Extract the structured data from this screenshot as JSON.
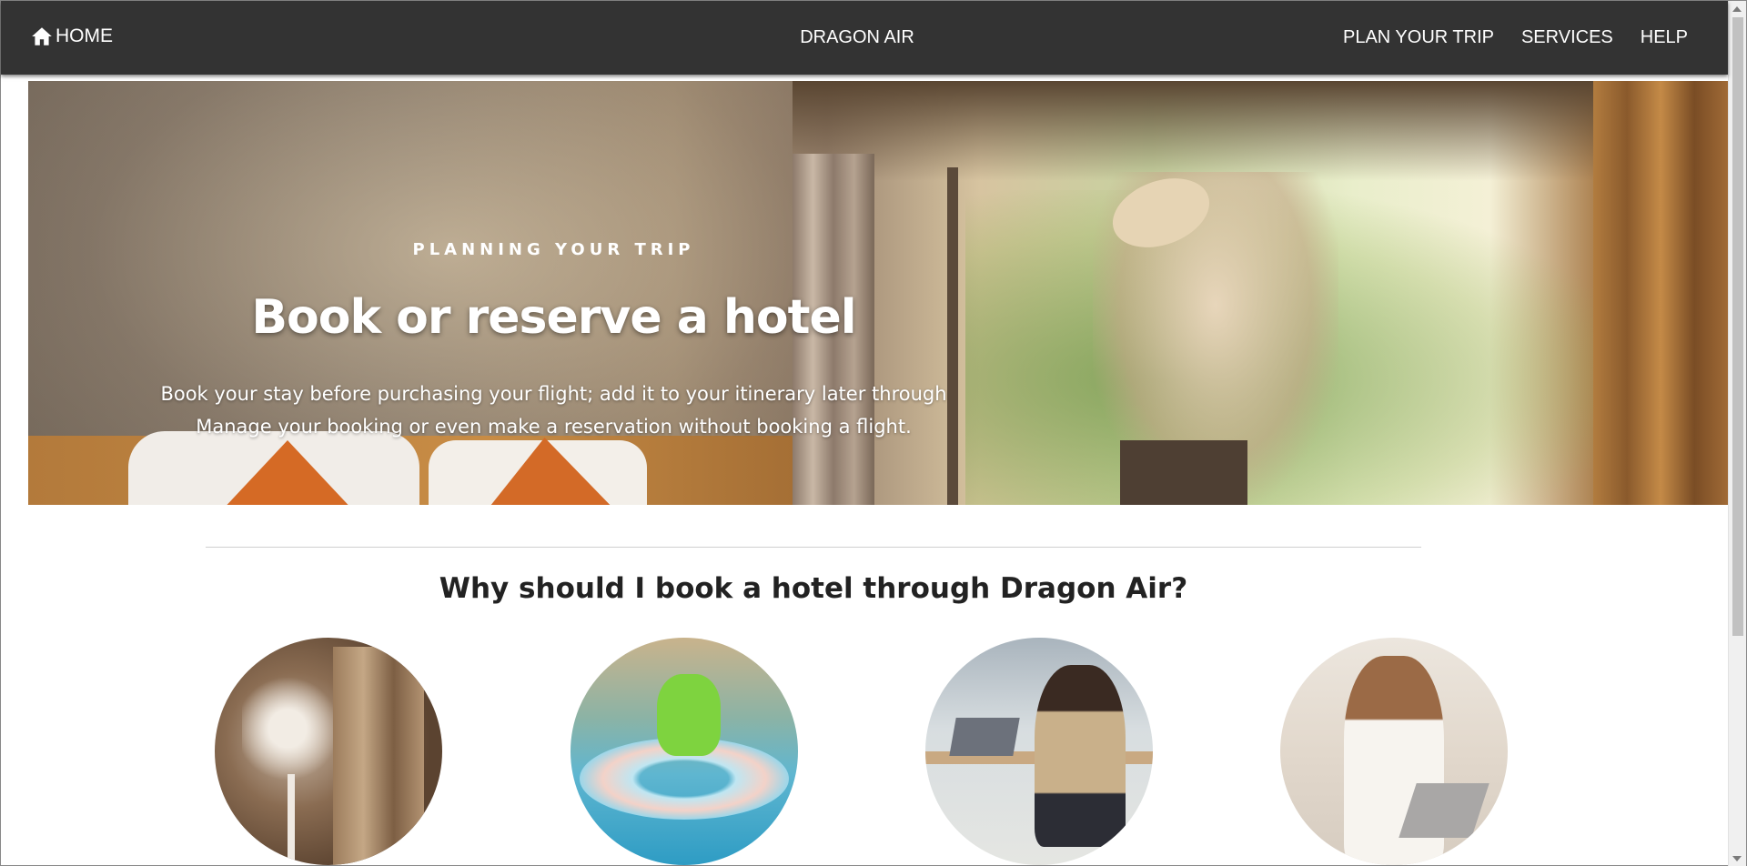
{
  "nav": {
    "home_label": "HOME",
    "home_icon": "home-icon",
    "brand": "DRAGON AIR",
    "links": [
      "PLAN YOUR TRIP",
      "SERVICES",
      "HELP"
    ]
  },
  "hero": {
    "eyebrow": "PLANNING YOUR TRIP",
    "title": "Book or reserve a hotel",
    "text_line1": "Book your stay before purchasing your flight; add it to your itinerary later through",
    "text_line2": "Manage your booking or even make a reservation without booking a flight."
  },
  "section": {
    "heading": "Why should I book a hotel through Dragon Air?",
    "images": [
      "hotel-interior-image",
      "family-pool-image",
      "woman-laptop-cafe-image",
      "woman-laptop-home-image"
    ]
  },
  "colors": {
    "navbar": "#333333",
    "text": "#222222"
  }
}
